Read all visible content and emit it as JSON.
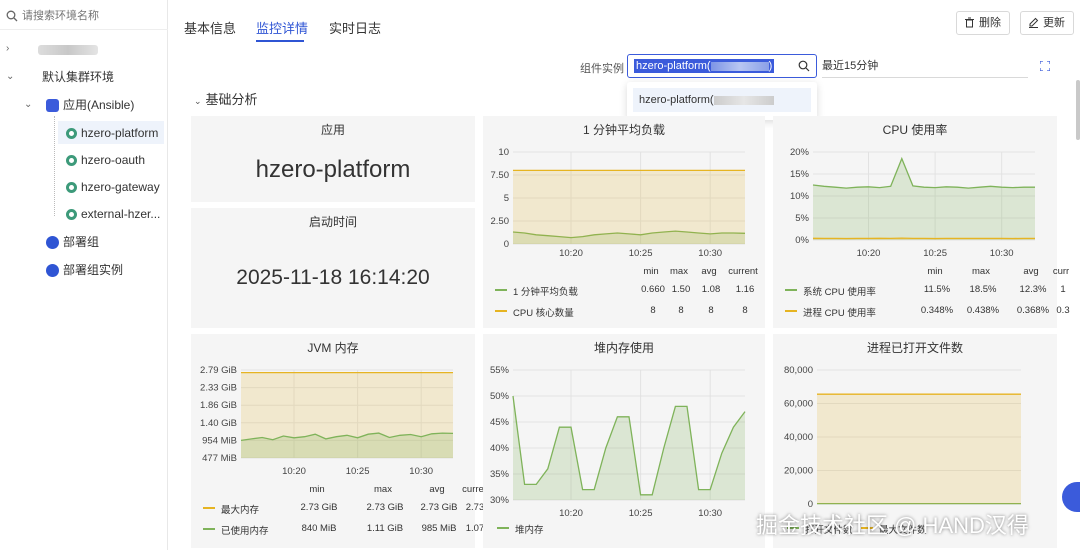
{
  "sidebar": {
    "search_placeholder": "请搜索环境名称",
    "root_label": "",
    "env_label": "默认集群环境",
    "app_label": "应用(Ansible)",
    "apps": [
      "hzero-platform",
      "hzero-oauth",
      "hzero-gateway",
      "external-hzer..."
    ],
    "deploy_group": "部署组",
    "deploy_instance": "部署组实例"
  },
  "tabs": [
    "基本信息",
    "监控详情",
    "实时日志"
  ],
  "actions": {
    "delete": "删除",
    "update": "更新"
  },
  "filter": {
    "label": "组件实例",
    "value": "hzero-platform(",
    "value_suffix": ")",
    "time_range": "最近15分钟",
    "dropdown_option": "hzero-platform("
  },
  "section_title": "基础分析",
  "panels": {
    "app": {
      "title": "应用",
      "value": "hzero-platform"
    },
    "start": {
      "title": "启动时间",
      "value": "2025-11-18 16:14:20"
    }
  },
  "colors": {
    "accent": "#2f55d4",
    "green": "#7fb35a",
    "yellow": "#e6b422"
  },
  "chart_data": [
    {
      "type": "line",
      "title": "1 分钟平均负载",
      "x_ticks": [
        "10:20",
        "10:25",
        "10:30"
      ],
      "y_ticks": [
        "0",
        "2.50",
        "5",
        "7.50",
        "10"
      ],
      "ylim": [
        0,
        10
      ],
      "legend_headers": [
        "min",
        "max",
        "avg",
        "current"
      ],
      "series": [
        {
          "name": "1 分钟平均负载",
          "color": "#7fb35a",
          "stats": [
            "0.660",
            "1.50",
            "1.08",
            "1.16"
          ],
          "values": [
            1.3,
            1.2,
            1.0,
            0.9,
            0.8,
            0.7,
            0.8,
            1.0,
            1.1,
            1.2,
            1.1,
            1.0,
            1.2,
            1.3,
            1.4,
            1.3,
            1.2,
            1.1,
            1.2,
            1.2,
            1.16
          ]
        },
        {
          "name": "CPU 核心数量",
          "color": "#e6b422",
          "stats": [
            "8",
            "8",
            "8",
            "8"
          ],
          "values": [
            8,
            8,
            8,
            8,
            8,
            8,
            8,
            8,
            8,
            8,
            8,
            8,
            8,
            8,
            8,
            8,
            8,
            8,
            8,
            8,
            8
          ]
        }
      ]
    },
    {
      "type": "line",
      "title": "CPU 使用率",
      "x_ticks": [
        "10:20",
        "10:25",
        "10:30"
      ],
      "y_ticks": [
        "0%",
        "5%",
        "10%",
        "15%",
        "20%"
      ],
      "ylim": [
        0,
        20
      ],
      "legend_headers": [
        "min",
        "max",
        "avg",
        "curr"
      ],
      "series": [
        {
          "name": "系统 CPU 使用率",
          "color": "#7fb35a",
          "stats": [
            "11.5%",
            "18.5%",
            "12.3%",
            "1"
          ],
          "values": [
            12.5,
            12.2,
            12.0,
            11.8,
            12.0,
            12.1,
            11.9,
            12.2,
            18.5,
            12.3,
            12.0,
            11.9,
            12.1,
            12.0,
            11.8,
            12.0,
            12.2,
            12.0,
            11.9,
            12.0,
            12.0
          ]
        },
        {
          "name": "进程 CPU 使用率",
          "color": "#e6b422",
          "stats": [
            "0.348%",
            "0.438%",
            "0.368%",
            "0.3"
          ],
          "values": [
            0.38,
            0.36,
            0.37,
            0.35,
            0.36,
            0.37,
            0.38,
            0.36,
            0.43,
            0.37,
            0.36,
            0.35,
            0.37,
            0.36,
            0.37,
            0.36,
            0.37,
            0.36,
            0.35,
            0.36,
            0.36
          ]
        }
      ]
    },
    {
      "type": "line",
      "title": "JVM 内存",
      "x_ticks": [
        "10:20",
        "10:25",
        "10:30"
      ],
      "y_ticks": [
        "477 MiB",
        "954 MiB",
        "1.40 GiB",
        "1.86 GiB",
        "2.33 GiB",
        "2.79 GiB"
      ],
      "ylim": [
        0.4,
        2.8
      ],
      "legend_headers": [
        "min",
        "max",
        "avg",
        "curre"
      ],
      "series": [
        {
          "name": "最大内存",
          "color": "#e6b422",
          "stats": [
            "2.73 GiB",
            "2.73 GiB",
            "2.73 GiB",
            "2.73"
          ],
          "values": [
            2.73,
            2.73,
            2.73,
            2.73,
            2.73,
            2.73,
            2.73,
            2.73,
            2.73,
            2.73,
            2.73,
            2.73,
            2.73,
            2.73,
            2.73,
            2.73,
            2.73,
            2.73,
            2.73,
            2.73,
            2.73
          ]
        },
        {
          "name": "已使用内存",
          "color": "#7fb35a",
          "stats": [
            "840 MiB",
            "1.11 GiB",
            "985 MiB",
            "1.07"
          ],
          "values": [
            0.88,
            0.92,
            0.96,
            0.9,
            1.0,
            0.95,
            0.98,
            1.05,
            0.92,
            0.98,
            1.02,
            0.95,
            1.05,
            1.08,
            0.96,
            1.02,
            1.04,
            0.98,
            1.06,
            1.08,
            1.07
          ]
        }
      ]
    },
    {
      "type": "line",
      "title": "堆内存使用",
      "x_ticks": [
        "10:20",
        "10:25",
        "10:30"
      ],
      "y_ticks": [
        "30%",
        "35%",
        "40%",
        "45%",
        "50%",
        "55%"
      ],
      "ylim": [
        30,
        55
      ],
      "series": [
        {
          "name": "堆内存",
          "color": "#7fb35a",
          "values": [
            50,
            33,
            33,
            36,
            44,
            44,
            32,
            32,
            40,
            46,
            46,
            31,
            31,
            40,
            48,
            48,
            32,
            32,
            39,
            44,
            47
          ]
        }
      ]
    },
    {
      "type": "line",
      "title": "进程已打开文件数",
      "x_ticks": [],
      "y_ticks": [
        "0",
        "20,000",
        "40,000",
        "60,000",
        "80,000"
      ],
      "ylim": [
        0,
        80000
      ],
      "series": [
        {
          "name": "打开文件数",
          "color": "#7fb35a",
          "values": [
            260,
            260,
            260,
            260,
            260,
            260,
            260,
            260,
            260,
            260,
            260,
            260,
            260,
            260,
            260,
            260,
            260,
            260,
            260,
            260,
            260
          ]
        },
        {
          "name": "最大文件数",
          "color": "#e6b422",
          "values": [
            65535,
            65535,
            65535,
            65535,
            65535,
            65535,
            65535,
            65535,
            65535,
            65535,
            65535,
            65535,
            65535,
            65535,
            65535,
            65535,
            65535,
            65535,
            65535,
            65535,
            65535
          ]
        }
      ]
    }
  ],
  "watermark": "掘金技术社区 @ HAND汉得"
}
